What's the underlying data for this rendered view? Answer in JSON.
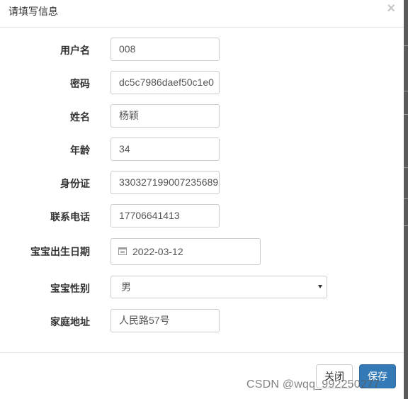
{
  "modal": {
    "title": "请填写信息",
    "close_symbol": "×"
  },
  "form": {
    "username": {
      "label": "用户名",
      "value": "008"
    },
    "password": {
      "label": "密码",
      "value": "dc5c7986daef50c1e0"
    },
    "name": {
      "label": "姓名",
      "value": "杨颖"
    },
    "age": {
      "label": "年龄",
      "value": "34"
    },
    "id_card": {
      "label": "身份证",
      "value": "330327199007235689"
    },
    "phone": {
      "label": "联系电话",
      "value": "17706641413"
    },
    "baby_birthdate": {
      "label": "宝宝出生日期",
      "value": "2022-03-12",
      "icon": "calendar-icon"
    },
    "baby_gender": {
      "label": "宝宝性别",
      "value": "男"
    },
    "address": {
      "label": "家庭地址",
      "value": "人民路57号"
    }
  },
  "footer": {
    "close_label": "关闭",
    "save_label": "保存"
  },
  "watermark": "CSDN @wqq_992250277",
  "colors": {
    "primary": "#337ab7",
    "border": "#cccccc",
    "divider": "#e5e5e5"
  }
}
